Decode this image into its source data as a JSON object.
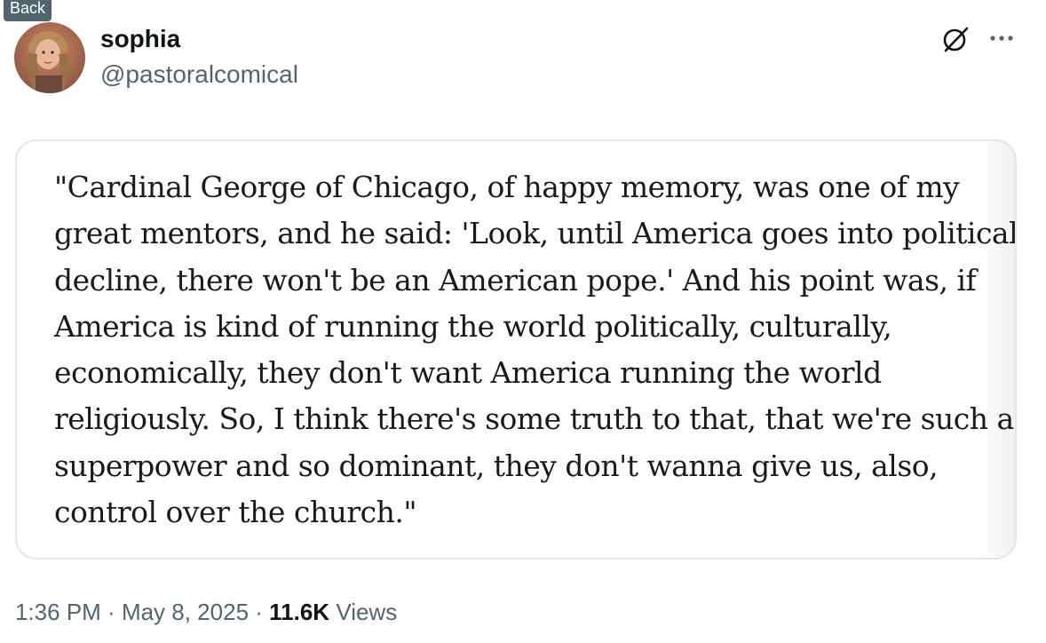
{
  "tooltip": {
    "label": "Back"
  },
  "author": {
    "display_name": "sophia",
    "handle": "@pastoralcomical"
  },
  "icons": {
    "grok": "grok-slash-circle-icon",
    "more": "more-horizontal-icon"
  },
  "quote": {
    "lines": [
      "\"Cardinal George of Chicago, of happy memory, was one of my",
      "great mentors, and he said: 'Look, until America goes into political",
      "decline, there won't be an American pope.' And his point was, if",
      "America is kind of running the world politically, culturally,",
      "economically, they don't want America running the world",
      "religiously. So, I think there's some truth to that, that we're such a",
      "superpower and so dominant, they don't wanna give us, also,",
      "control over the church.\""
    ]
  },
  "meta": {
    "time": "1:36 PM",
    "separator": " · ",
    "date": "May 8, 2025",
    "views_count": "11.6K",
    "views_label": " Views"
  },
  "colors": {
    "text_primary": "#0f1419",
    "text_secondary": "#536471",
    "border": "#e3e7ea"
  }
}
